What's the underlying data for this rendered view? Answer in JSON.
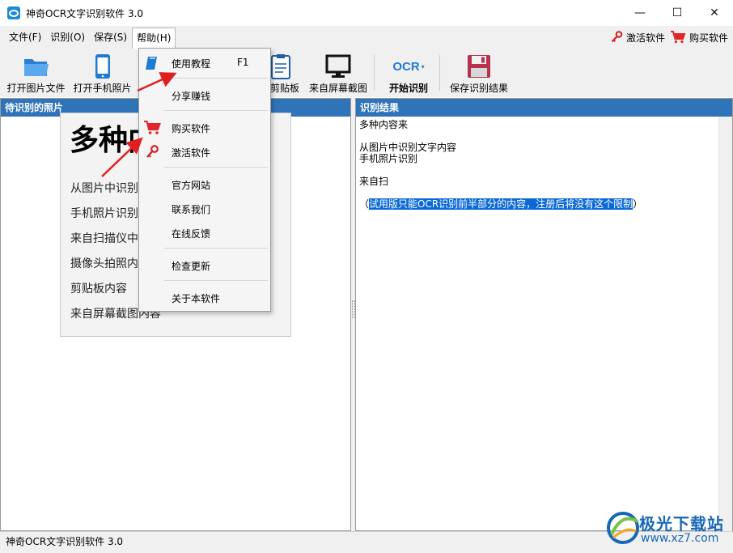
{
  "window": {
    "title": "神奇OCR文字识别软件 3.0",
    "controls": {
      "minimize": "—",
      "maximize": "☐",
      "close": "✕"
    }
  },
  "menubar": {
    "items": [
      {
        "label": "文件(F)"
      },
      {
        "label": "识别(O)"
      },
      {
        "label": "保存(S)"
      },
      {
        "label": "帮助(H)"
      }
    ],
    "right": {
      "activate": "激活软件",
      "buy": "购买软件"
    }
  },
  "toolbar": {
    "open_image": "打开图片文件",
    "open_phone": "打开手机照片",
    "clipboard": "剪贴板",
    "screenshot": "来自屏幕截图",
    "ocr_icon_text": "OCR",
    "start_ocr": "开始识别",
    "save_result": "保存识别结果"
  },
  "left_panel": {
    "header": "待识别的照片",
    "photo": {
      "title": "多种内",
      "lines": [
        "从图片中识别",
        "手机照片识别",
        "来自扫描仪中内容",
        "摄像头拍照内容",
        "剪贴板内容",
        "来自屏幕截图内容"
      ]
    }
  },
  "right_panel": {
    "header": "识别结果",
    "lines": [
      "多种内容来",
      "",
      "从图片中识别文字内容",
      "手机照片识别",
      "",
      "来自扫",
      "",
      "（试用版只能OCR识别前半部分的内容，注册后将没有这个限制）"
    ],
    "trial_open": "（",
    "trial_text": "试用版只能OCR识别前半部分的内容，注册后将没有这个限制",
    "trial_close": "）"
  },
  "help_menu": {
    "items": [
      {
        "label": "使用教程",
        "shortcut": "F1",
        "icon": "book-icon"
      },
      {
        "label": "分享赚钱"
      },
      {
        "label": "购买软件",
        "icon": "cart-icon"
      },
      {
        "label": "激活软件",
        "icon": "key-icon"
      },
      {
        "label": "官方网站"
      },
      {
        "label": "联系我们"
      },
      {
        "label": "在线反馈"
      },
      {
        "label": "检查更新"
      },
      {
        "label": "关于本软件"
      }
    ]
  },
  "statusbar": {
    "text": "神奇OCR文字识别软件 3.0"
  },
  "watermark": {
    "title": "极光下载站",
    "url": "www.xz7.com"
  },
  "colors": {
    "panel_header": "#2f73b9",
    "highlight": "#0a69d7",
    "arrow": "#e02020",
    "cart": "#e0262a"
  }
}
